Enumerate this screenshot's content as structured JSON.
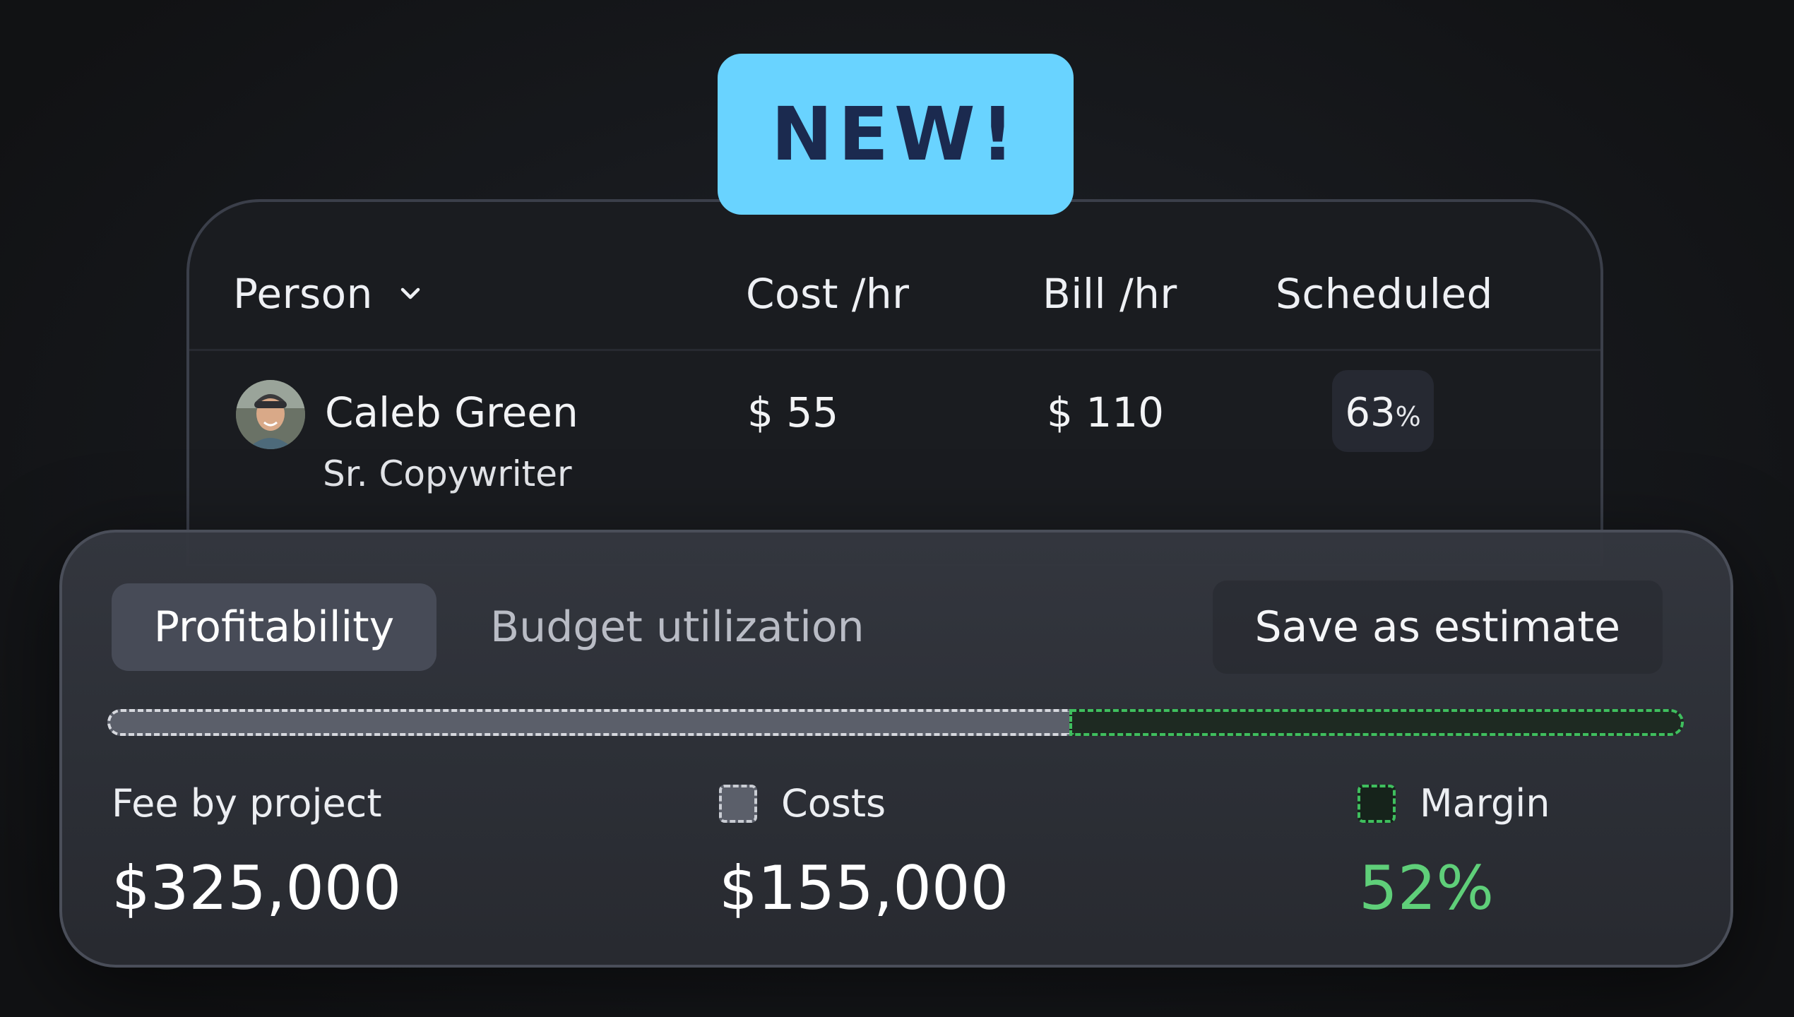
{
  "badge": {
    "text": "NEW!",
    "color": "#69d3ff"
  },
  "table": {
    "headers": {
      "person": "Person",
      "cost": "Cost /hr",
      "bill": "Bill /hr",
      "scheduled": "Scheduled"
    },
    "rows": [
      {
        "name": "Caleb Green",
        "role": "Sr. Copywriter",
        "cost": "$ 55",
        "bill": "$ 110",
        "scheduled_value": "63",
        "scheduled_unit": "%"
      }
    ]
  },
  "panel": {
    "tabs": [
      {
        "label": "Profitability",
        "active": true
      },
      {
        "label": "Budget utilization",
        "active": false
      }
    ],
    "save_label": "Save as estimate",
    "bar": {
      "costs_fraction": 0.61,
      "margin_fraction": 0.39
    },
    "stats": {
      "fee": {
        "label": "Fee by project",
        "value": "$325,000"
      },
      "costs": {
        "label": "Costs",
        "value": "$155,000"
      },
      "margin": {
        "label": "Margin",
        "value": "52%",
        "color": "#5fcf79"
      }
    }
  },
  "icons": {
    "dropdown": "chevron-down-icon",
    "avatar": "avatar"
  }
}
